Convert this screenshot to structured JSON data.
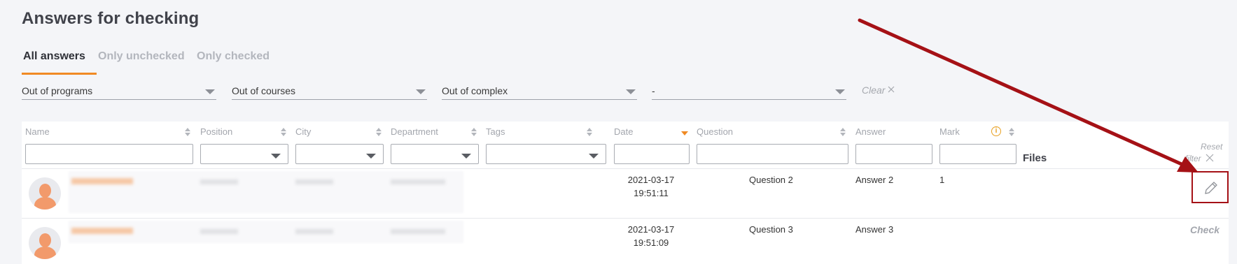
{
  "page": {
    "title": "Answers for checking"
  },
  "tabs": [
    {
      "label": "All answers",
      "active": true
    },
    {
      "label": "Only unchecked",
      "active": false
    },
    {
      "label": "Only checked",
      "active": false
    }
  ],
  "filters": {
    "programs": "Out of programs",
    "courses": "Out of courses",
    "complex": "Out of complex",
    "extra": "-",
    "clear_label": "Clear"
  },
  "table": {
    "columns": {
      "name": "Name",
      "position": "Position",
      "city": "City",
      "department": "Department",
      "tags": "Tags",
      "date": "Date",
      "question": "Question",
      "answer": "Answer",
      "mark": "Mark",
      "files": "Files"
    },
    "reset_line1": "Reset",
    "reset_line2": "filter",
    "rows": [
      {
        "date": "2021-03-17",
        "time": "19:51:11",
        "question": "Question 2",
        "answer": "Answer 2",
        "mark": "1",
        "action": ""
      },
      {
        "date": "2021-03-17",
        "time": "19:51:09",
        "question": "Question 3",
        "answer": "Answer 3",
        "mark": "",
        "action": "Check"
      }
    ]
  },
  "colors": {
    "accent": "#f08a24",
    "annotation": "#a51116"
  },
  "icons": {
    "clear": "close-icon",
    "reset": "close-icon",
    "edit": "pencil-icon",
    "mark_info": "info-icon",
    "avatar": "user-avatar-icon"
  }
}
